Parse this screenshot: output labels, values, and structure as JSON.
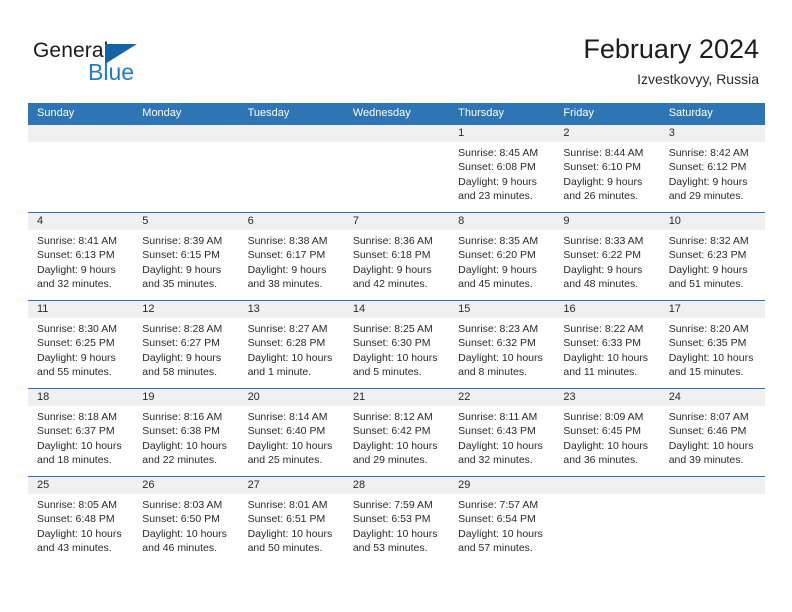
{
  "brand": {
    "name_part1": "General",
    "name_part2": "Blue",
    "triangle_color": "#1464a5",
    "blue_color": "#1f7ec4"
  },
  "header": {
    "title": "February 2024",
    "subtitle": "Izvestkovyy, Russia"
  },
  "theme": {
    "header_blue": "#2e75b6",
    "daynum_band": "#f0f0f0",
    "text": "#2a2a2a"
  },
  "weekdays": [
    "Sunday",
    "Monday",
    "Tuesday",
    "Wednesday",
    "Thursday",
    "Friday",
    "Saturday"
  ],
  "weeks": [
    [
      {
        "day": "",
        "sunrise": "",
        "sunset": "",
        "daylight1": "",
        "daylight2": ""
      },
      {
        "day": "",
        "sunrise": "",
        "sunset": "",
        "daylight1": "",
        "daylight2": ""
      },
      {
        "day": "",
        "sunrise": "",
        "sunset": "",
        "daylight1": "",
        "daylight2": ""
      },
      {
        "day": "",
        "sunrise": "",
        "sunset": "",
        "daylight1": "",
        "daylight2": ""
      },
      {
        "day": "1",
        "sunrise": "Sunrise: 8:45 AM",
        "sunset": "Sunset: 6:08 PM",
        "daylight1": "Daylight: 9 hours",
        "daylight2": "and 23 minutes."
      },
      {
        "day": "2",
        "sunrise": "Sunrise: 8:44 AM",
        "sunset": "Sunset: 6:10 PM",
        "daylight1": "Daylight: 9 hours",
        "daylight2": "and 26 minutes."
      },
      {
        "day": "3",
        "sunrise": "Sunrise: 8:42 AM",
        "sunset": "Sunset: 6:12 PM",
        "daylight1": "Daylight: 9 hours",
        "daylight2": "and 29 minutes."
      }
    ],
    [
      {
        "day": "4",
        "sunrise": "Sunrise: 8:41 AM",
        "sunset": "Sunset: 6:13 PM",
        "daylight1": "Daylight: 9 hours",
        "daylight2": "and 32 minutes."
      },
      {
        "day": "5",
        "sunrise": "Sunrise: 8:39 AM",
        "sunset": "Sunset: 6:15 PM",
        "daylight1": "Daylight: 9 hours",
        "daylight2": "and 35 minutes."
      },
      {
        "day": "6",
        "sunrise": "Sunrise: 8:38 AM",
        "sunset": "Sunset: 6:17 PM",
        "daylight1": "Daylight: 9 hours",
        "daylight2": "and 38 minutes."
      },
      {
        "day": "7",
        "sunrise": "Sunrise: 8:36 AM",
        "sunset": "Sunset: 6:18 PM",
        "daylight1": "Daylight: 9 hours",
        "daylight2": "and 42 minutes."
      },
      {
        "day": "8",
        "sunrise": "Sunrise: 8:35 AM",
        "sunset": "Sunset: 6:20 PM",
        "daylight1": "Daylight: 9 hours",
        "daylight2": "and 45 minutes."
      },
      {
        "day": "9",
        "sunrise": "Sunrise: 8:33 AM",
        "sunset": "Sunset: 6:22 PM",
        "daylight1": "Daylight: 9 hours",
        "daylight2": "and 48 minutes."
      },
      {
        "day": "10",
        "sunrise": "Sunrise: 8:32 AM",
        "sunset": "Sunset: 6:23 PM",
        "daylight1": "Daylight: 9 hours",
        "daylight2": "and 51 minutes."
      }
    ],
    [
      {
        "day": "11",
        "sunrise": "Sunrise: 8:30 AM",
        "sunset": "Sunset: 6:25 PM",
        "daylight1": "Daylight: 9 hours",
        "daylight2": "and 55 minutes."
      },
      {
        "day": "12",
        "sunrise": "Sunrise: 8:28 AM",
        "sunset": "Sunset: 6:27 PM",
        "daylight1": "Daylight: 9 hours",
        "daylight2": "and 58 minutes."
      },
      {
        "day": "13",
        "sunrise": "Sunrise: 8:27 AM",
        "sunset": "Sunset: 6:28 PM",
        "daylight1": "Daylight: 10 hours",
        "daylight2": "and 1 minute."
      },
      {
        "day": "14",
        "sunrise": "Sunrise: 8:25 AM",
        "sunset": "Sunset: 6:30 PM",
        "daylight1": "Daylight: 10 hours",
        "daylight2": "and 5 minutes."
      },
      {
        "day": "15",
        "sunrise": "Sunrise: 8:23 AM",
        "sunset": "Sunset: 6:32 PM",
        "daylight1": "Daylight: 10 hours",
        "daylight2": "and 8 minutes."
      },
      {
        "day": "16",
        "sunrise": "Sunrise: 8:22 AM",
        "sunset": "Sunset: 6:33 PM",
        "daylight1": "Daylight: 10 hours",
        "daylight2": "and 11 minutes."
      },
      {
        "day": "17",
        "sunrise": "Sunrise: 8:20 AM",
        "sunset": "Sunset: 6:35 PM",
        "daylight1": "Daylight: 10 hours",
        "daylight2": "and 15 minutes."
      }
    ],
    [
      {
        "day": "18",
        "sunrise": "Sunrise: 8:18 AM",
        "sunset": "Sunset: 6:37 PM",
        "daylight1": "Daylight: 10 hours",
        "daylight2": "and 18 minutes."
      },
      {
        "day": "19",
        "sunrise": "Sunrise: 8:16 AM",
        "sunset": "Sunset: 6:38 PM",
        "daylight1": "Daylight: 10 hours",
        "daylight2": "and 22 minutes."
      },
      {
        "day": "20",
        "sunrise": "Sunrise: 8:14 AM",
        "sunset": "Sunset: 6:40 PM",
        "daylight1": "Daylight: 10 hours",
        "daylight2": "and 25 minutes."
      },
      {
        "day": "21",
        "sunrise": "Sunrise: 8:12 AM",
        "sunset": "Sunset: 6:42 PM",
        "daylight1": "Daylight: 10 hours",
        "daylight2": "and 29 minutes."
      },
      {
        "day": "22",
        "sunrise": "Sunrise: 8:11 AM",
        "sunset": "Sunset: 6:43 PM",
        "daylight1": "Daylight: 10 hours",
        "daylight2": "and 32 minutes."
      },
      {
        "day": "23",
        "sunrise": "Sunrise: 8:09 AM",
        "sunset": "Sunset: 6:45 PM",
        "daylight1": "Daylight: 10 hours",
        "daylight2": "and 36 minutes."
      },
      {
        "day": "24",
        "sunrise": "Sunrise: 8:07 AM",
        "sunset": "Sunset: 6:46 PM",
        "daylight1": "Daylight: 10 hours",
        "daylight2": "and 39 minutes."
      }
    ],
    [
      {
        "day": "25",
        "sunrise": "Sunrise: 8:05 AM",
        "sunset": "Sunset: 6:48 PM",
        "daylight1": "Daylight: 10 hours",
        "daylight2": "and 43 minutes."
      },
      {
        "day": "26",
        "sunrise": "Sunrise: 8:03 AM",
        "sunset": "Sunset: 6:50 PM",
        "daylight1": "Daylight: 10 hours",
        "daylight2": "and 46 minutes."
      },
      {
        "day": "27",
        "sunrise": "Sunrise: 8:01 AM",
        "sunset": "Sunset: 6:51 PM",
        "daylight1": "Daylight: 10 hours",
        "daylight2": "and 50 minutes."
      },
      {
        "day": "28",
        "sunrise": "Sunrise: 7:59 AM",
        "sunset": "Sunset: 6:53 PM",
        "daylight1": "Daylight: 10 hours",
        "daylight2": "and 53 minutes."
      },
      {
        "day": "29",
        "sunrise": "Sunrise: 7:57 AM",
        "sunset": "Sunset: 6:54 PM",
        "daylight1": "Daylight: 10 hours",
        "daylight2": "and 57 minutes."
      },
      {
        "day": "",
        "sunrise": "",
        "sunset": "",
        "daylight1": "",
        "daylight2": ""
      },
      {
        "day": "",
        "sunrise": "",
        "sunset": "",
        "daylight1": "",
        "daylight2": ""
      }
    ]
  ]
}
